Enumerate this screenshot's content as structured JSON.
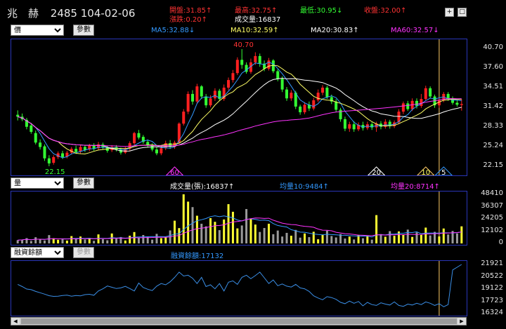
{
  "header": {
    "name": "兆　赫",
    "code": "2485",
    "date": "104-02-06",
    "quotes": [
      {
        "label": "開盤:",
        "value": "31.85",
        "arrow": "↑",
        "color": "#ff3333"
      },
      {
        "label": "最高:",
        "value": "32.75",
        "arrow": "↑",
        "color": "#ff3333"
      },
      {
        "label": "最低:",
        "value": "30.95",
        "arrow": "↓",
        "color": "#33ff33"
      },
      {
        "label": "收盤:",
        "value": "32.00",
        "arrow": "↑",
        "color": "#ff3333"
      },
      {
        "label": "漲跌:",
        "value": "0.20",
        "arrow": "↑",
        "color": "#ff3333"
      },
      {
        "label": "成交量:",
        "value": "16837",
        "arrow": "",
        "color": "#ffffff"
      }
    ],
    "buttons": [
      "+",
      "□"
    ]
  },
  "price_bar": {
    "select": "價",
    "button": "參數",
    "ma": [
      {
        "text": "MA5:32.88↓",
        "color": "#3399ff"
      },
      {
        "text": "MA10:32.59↑",
        "color": "#ffff66"
      },
      {
        "text": "MA20:30.83↑",
        "color": "#ffffff"
      },
      {
        "text": "MA60:32.57↓",
        "color": "#ff33ff"
      }
    ]
  },
  "price_axis": [
    "40.70",
    "37.60",
    "34.51",
    "31.42",
    "28.33",
    "25.24",
    "22.15"
  ],
  "price_marks": {
    "high": "40.70",
    "low": "22.15",
    "tags": [
      "60",
      "20",
      "10",
      "5"
    ]
  },
  "volume_bar": {
    "select": "量",
    "button": "參數",
    "labels": [
      {
        "text": "成交量(張):16837↑",
        "color": "#ffffff"
      },
      {
        "text": "均量10:9484↑",
        "color": "#3399ff"
      },
      {
        "text": "均量20:8714↑",
        "color": "#ff33ff"
      }
    ]
  },
  "volume_axis": [
    "48410",
    "36307",
    "24205",
    "12102",
    "0"
  ],
  "margin_bar": {
    "select": "融資餘額",
    "button": "參數",
    "label": {
      "text": "融資餘額:17132",
      "color": "#3399ff"
    }
  },
  "margin_axis": [
    "21921",
    "20522",
    "19122",
    "17723",
    "16324"
  ],
  "colors": {
    "up": "#ff2020",
    "down": "#33ff33",
    "panel_border": "#2a36b8",
    "cursor": "#ffcc66"
  },
  "chart_data": {
    "type": "candlestick",
    "ylim": [
      22.15,
      40.7
    ],
    "candles": [
      [
        30.3,
        30.0,
        31.0,
        29.4
      ],
      [
        30.0,
        29.6,
        30.5,
        29.3
      ],
      [
        29.5,
        28.4,
        29.8,
        28.0
      ],
      [
        28.6,
        27.6,
        29.0,
        27.3
      ],
      [
        27.4,
        25.9,
        27.8,
        25.6
      ],
      [
        25.9,
        25.2,
        26.4,
        24.8
      ],
      [
        25.3,
        23.4,
        25.6,
        23.0
      ],
      [
        23.4,
        22.6,
        23.9,
        22.15
      ],
      [
        22.7,
        23.6,
        23.9,
        22.4
      ],
      [
        23.6,
        24.2,
        24.5,
        23.3
      ],
      [
        24.2,
        23.6,
        24.6,
        23.3
      ],
      [
        23.7,
        24.3,
        24.6,
        23.4
      ],
      [
        24.3,
        24.9,
        25.2,
        24.0
      ],
      [
        24.9,
        24.4,
        25.4,
        24.1
      ],
      [
        24.5,
        25.2,
        25.6,
        24.2
      ],
      [
        25.2,
        24.7,
        25.5,
        24.4
      ],
      [
        24.8,
        25.4,
        25.7,
        24.5
      ],
      [
        25.4,
        24.9,
        25.8,
        24.6
      ],
      [
        25.0,
        25.6,
        26.0,
        24.7
      ],
      [
        25.6,
        25.1,
        25.9,
        24.8
      ],
      [
        25.1,
        24.6,
        25.4,
        24.3
      ],
      [
        24.7,
        25.2,
        25.5,
        24.4
      ],
      [
        25.2,
        24.8,
        25.5,
        24.5
      ],
      [
        24.8,
        24.3,
        25.1,
        24.0
      ],
      [
        24.3,
        24.9,
        25.2,
        24.1
      ],
      [
        24.9,
        25.8,
        26.1,
        24.6
      ],
      [
        25.8,
        27.4,
        27.6,
        25.5
      ],
      [
        27.4,
        26.7,
        27.9,
        26.4
      ],
      [
        26.8,
        26.0,
        27.1,
        25.7
      ],
      [
        26.0,
        25.5,
        26.4,
        25.1
      ],
      [
        25.5,
        24.8,
        25.8,
        24.5
      ],
      [
        24.8,
        24.2,
        25.2,
        23.9
      ],
      [
        24.2,
        25.0,
        25.4,
        23.9
      ],
      [
        25.0,
        25.8,
        26.2,
        24.7
      ],
      [
        25.8,
        25.2,
        26.3,
        24.9
      ],
      [
        25.2,
        25.9,
        26.2,
        24.9
      ],
      [
        25.9,
        28.9,
        29.1,
        25.7
      ],
      [
        28.9,
        30.8,
        31.2,
        28.6
      ],
      [
        30.8,
        33.6,
        34.0,
        30.4
      ],
      [
        33.6,
        32.4,
        34.2,
        31.9
      ],
      [
        32.4,
        34.8,
        35.2,
        32.1
      ],
      [
        34.8,
        33.2,
        35.0,
        32.8
      ],
      [
        33.2,
        31.8,
        33.6,
        31.4
      ],
      [
        31.8,
        32.9,
        33.4,
        31.5
      ],
      [
        32.9,
        34.1,
        34.5,
        32.5
      ],
      [
        34.1,
        32.8,
        34.4,
        32.5
      ],
      [
        32.8,
        34.6,
        35.1,
        32.5
      ],
      [
        34.6,
        35.8,
        36.2,
        34.2
      ],
      [
        35.8,
        36.9,
        37.4,
        35.4
      ],
      [
        36.9,
        39.0,
        39.4,
        36.6
      ],
      [
        39.0,
        38.2,
        40.7,
        37.6
      ],
      [
        38.2,
        37.1,
        38.6,
        36.8
      ],
      [
        37.1,
        38.6,
        39.2,
        36.8
      ],
      [
        38.6,
        39.6,
        40.2,
        38.2
      ],
      [
        39.6,
        38.4,
        40.0,
        37.9
      ],
      [
        38.4,
        37.6,
        38.9,
        37.2
      ],
      [
        37.6,
        38.9,
        39.3,
        37.3
      ],
      [
        38.9,
        37.2,
        39.1,
        36.9
      ],
      [
        37.2,
        36.0,
        37.5,
        35.6
      ],
      [
        36.0,
        34.3,
        36.4,
        33.9
      ],
      [
        34.3,
        32.9,
        34.7,
        32.5
      ],
      [
        32.9,
        33.8,
        34.2,
        32.5
      ],
      [
        33.8,
        31.6,
        34.1,
        31.2
      ],
      [
        31.6,
        30.7,
        31.9,
        30.3
      ],
      [
        30.7,
        31.9,
        32.3,
        30.4
      ],
      [
        31.9,
        31.3,
        32.4,
        30.9
      ],
      [
        31.3,
        32.6,
        33.0,
        31.0
      ],
      [
        32.6,
        33.8,
        34.3,
        32.3
      ],
      [
        33.8,
        34.6,
        35.0,
        33.4
      ],
      [
        34.6,
        33.1,
        34.9,
        32.8
      ],
      [
        33.1,
        32.4,
        33.5,
        32.0
      ],
      [
        32.4,
        31.1,
        32.8,
        30.7
      ],
      [
        31.1,
        29.6,
        31.4,
        29.2
      ],
      [
        29.6,
        28.1,
        30.0,
        27.7
      ],
      [
        28.1,
        28.8,
        29.2,
        27.6
      ],
      [
        28.8,
        28.0,
        29.3,
        27.6
      ],
      [
        28.0,
        28.7,
        29.1,
        27.7
      ],
      [
        28.7,
        28.2,
        29.2,
        27.8
      ],
      [
        28.2,
        28.8,
        29.2,
        27.9
      ],
      [
        28.8,
        28.3,
        29.1,
        27.9
      ],
      [
        28.3,
        28.9,
        29.2,
        27.6
      ],
      [
        28.9,
        28.4,
        29.3,
        28.0
      ],
      [
        28.4,
        29.2,
        29.6,
        28.1
      ],
      [
        29.2,
        28.5,
        29.5,
        28.1
      ],
      [
        28.5,
        29.1,
        29.4,
        28.2
      ],
      [
        29.1,
        30.8,
        31.2,
        28.8
      ],
      [
        30.8,
        32.1,
        32.4,
        30.4
      ],
      [
        32.1,
        31.2,
        32.5,
        30.9
      ],
      [
        31.2,
        32.5,
        32.9,
        30.9
      ],
      [
        32.5,
        31.7,
        32.9,
        31.3
      ],
      [
        31.7,
        32.8,
        33.6,
        31.4
      ],
      [
        32.8,
        34.5,
        34.9,
        32.5
      ],
      [
        34.5,
        33.2,
        34.8,
        32.9
      ],
      [
        33.2,
        31.8,
        33.5,
        31.4
      ],
      [
        31.8,
        32.6,
        32.9,
        31.4
      ],
      [
        32.6,
        33.6,
        33.9,
        32.3
      ],
      [
        33.6,
        32.9,
        33.9,
        32.5
      ],
      [
        32.9,
        32.2,
        33.2,
        31.9
      ],
      [
        32.2,
        31.9,
        32.6,
        31.6
      ],
      [
        31.85,
        32.0,
        32.75,
        30.95
      ]
    ],
    "volume": [
      3200,
      3800,
      5200,
      2400,
      6100,
      4300,
      2900,
      8200,
      5100,
      3600,
      4100,
      2800,
      7200,
      4500,
      6800,
      3900,
      5300,
      2600,
      8900,
      4200,
      3100,
      9800,
      4700,
      6300,
      2900,
      7600,
      11200,
      5400,
      8300,
      6900,
      3700,
      9400,
      5200,
      6100,
      12800,
      22400,
      15100,
      48410,
      41200,
      35800,
      27300,
      19400,
      16800,
      24900,
      21300,
      13100,
      23600,
      38700,
      31200,
      14800,
      17700,
      33900,
      24300,
      18600,
      11300,
      15200,
      19400,
      9100,
      12700,
      6800,
      10400,
      7600,
      13300,
      5700,
      9800,
      6200,
      11500,
      4100,
      8700,
      12600,
      7300,
      5900,
      9200,
      4800,
      6700,
      3900,
      8400,
      5100,
      7700,
      3700,
      27900,
      9200,
      6600,
      12100,
      7500,
      11800,
      8700,
      13600,
      6400,
      10900,
      8300,
      15600,
      7900,
      11400,
      6900,
      14700,
      8800,
      12300,
      9900,
      16837
    ],
    "margin": [
      19650,
      19400,
      19120,
      19050,
      18850,
      18700,
      18540,
      18360,
      18280,
      18300,
      18380,
      18420,
      18310,
      18380,
      18350,
      18480,
      18520,
      18410,
      18900,
      19150,
      19470,
      19320,
      19180,
      19250,
      19430,
      19180,
      18900,
      19800,
      19300,
      19100,
      18950,
      19450,
      19750,
      19600,
      19950,
      20450,
      21050,
      20600,
      20700,
      20350,
      19750,
      20450,
      19400,
      19600,
      19150,
      19750,
      18900,
      19900,
      20050,
      19650,
      20450,
      20700,
      20300,
      20650,
      21050,
      20400,
      19750,
      20150,
      19500,
      19700,
      19450,
      19350,
      19650,
      19250,
      19150,
      18850,
      18350,
      18100,
      17900,
      18250,
      18150,
      17950,
      17600,
      17450,
      17750,
      17500,
      17700,
      17200,
      17600,
      17350,
      17250,
      17550,
      17400,
      17300,
      17650,
      17250,
      17150,
      17400,
      17300,
      17500,
      17350,
      17650,
      17500,
      17250,
      17450,
      17100,
      17350,
      21300,
      21600,
      21921
    ]
  }
}
